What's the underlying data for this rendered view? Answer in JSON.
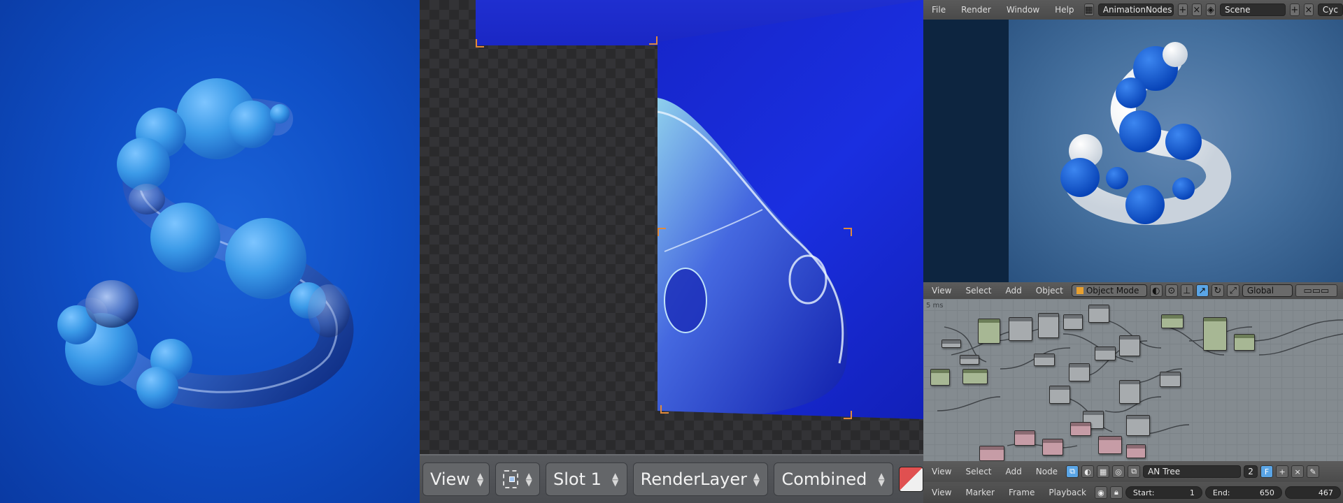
{
  "middle": {
    "header": {
      "view_label": "View",
      "slot_label": "Slot 1",
      "render_layer_label": "RenderLayer",
      "pass_label": "Combined"
    }
  },
  "blender": {
    "info_header": {
      "menus": [
        "File",
        "Render",
        "Window",
        "Help"
      ],
      "screen_name": "AnimationNodes",
      "scene_name": "Scene",
      "engine_label": "Cyc"
    },
    "viewport_header": {
      "menus": [
        "View",
        "Select",
        "Add",
        "Object"
      ],
      "mode_label": "Object Mode",
      "orientation_label": "Global"
    },
    "node_editor": {
      "timing_text": "5 ms"
    },
    "node_header": {
      "menus": [
        "View",
        "Select",
        "Add",
        "Node"
      ],
      "tree_name": "AN Tree",
      "users_count": "2",
      "fake_user_label": "F"
    },
    "timeline_header": {
      "menus": [
        "View",
        "Marker",
        "Frame",
        "Playback"
      ],
      "start_label": "Start:",
      "start_value": "1",
      "end_label": "End:",
      "end_value": "650",
      "current_frame": "467"
    }
  },
  "colors": {
    "left_background": "#0f4fc6",
    "sphere_light_blue": "#3b9ae8",
    "viewport_sphere_blue": "#0a55d8",
    "viewport_white": "#f2f2f2",
    "render_blue": "#1a2fe0"
  }
}
